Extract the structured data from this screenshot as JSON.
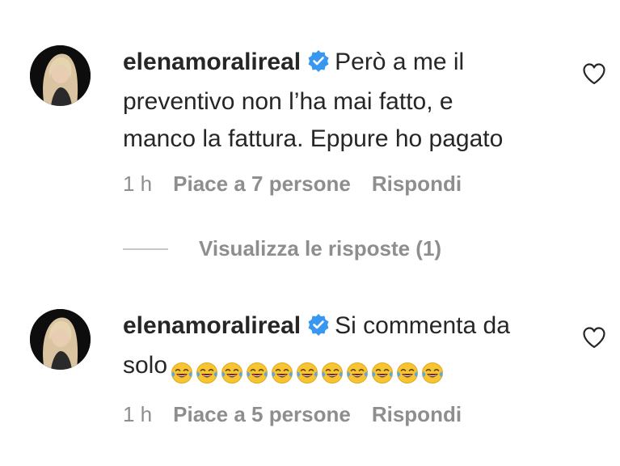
{
  "comments": [
    {
      "username": "elenamoralireal",
      "text_line1": "Però a me il",
      "text_line2": "preventivo non l’ha mai fatto, e",
      "text_line3": "manco la fattura. Eppure ho pagato",
      "time": "1 h",
      "likes": "Piace a 7 persone",
      "reply": "Rispondi"
    },
    {
      "username": "elenamoralireal",
      "text_line1": "Si commenta da",
      "text_line2": "solo",
      "emoji_icon": "tears-of-joy-emoji",
      "emoji_count": 11,
      "time": "1 h",
      "likes": "Piace a 5 persone",
      "reply": "Rispondi"
    }
  ],
  "view_replies": "Visualizza le risposte (1)",
  "colors": {
    "text": "#262626",
    "muted": "#8e8e8e",
    "verified": "#3897f0"
  }
}
